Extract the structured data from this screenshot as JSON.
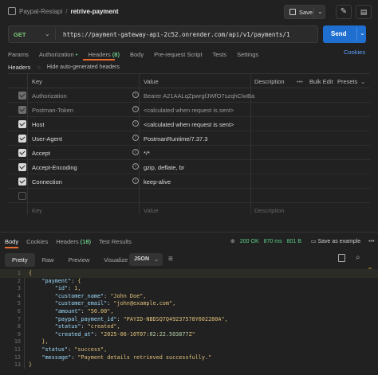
{
  "topbar": {
    "collection": "Paypal-Restapi",
    "separator": "/",
    "request_name": "retrive-payment",
    "save_label": "Save"
  },
  "request": {
    "method": "GET",
    "url": "https://payment-gateway-api-2c52.onrender.com/api/v1/payments/1",
    "send_label": "Send"
  },
  "tabs": [
    {
      "label": "Params"
    },
    {
      "label": "Authorization",
      "dot": "•"
    },
    {
      "label": "Headers",
      "count": "(8)"
    },
    {
      "label": "Body"
    },
    {
      "label": "Pre-request Script"
    },
    {
      "label": "Tests"
    },
    {
      "label": "Settings"
    }
  ],
  "cookies_label": "Cookies",
  "headers_section": {
    "title": "Headers",
    "hide_label": "Hide auto-generated headers",
    "col_key": "Key",
    "col_value": "Value",
    "col_description": "Description",
    "more": "•••",
    "bulk_edit": "Bulk Edit",
    "presets": "Presets",
    "rows": [
      {
        "key": "Authorization",
        "value": "Bearer A21AALqZpwrgfJWfO7szqhClwBa...",
        "state": "dim"
      },
      {
        "key": "Postman-Token",
        "value": "<calculated when request is sent>",
        "state": "dim"
      },
      {
        "key": "Host",
        "value": "<calculated when request is sent>",
        "state": "on"
      },
      {
        "key": "User-Agent",
        "value": "PostmanRuntime/7.37.3",
        "state": "on"
      },
      {
        "key": "Accept",
        "value": "*/*",
        "state": "on"
      },
      {
        "key": "Accept-Encoding",
        "value": "gzip, deflate, br",
        "state": "on"
      },
      {
        "key": "Connection",
        "value": "keep-alive",
        "state": "on"
      }
    ],
    "placeholder_key": "Key",
    "placeholder_value": "Value",
    "placeholder_description": "Description"
  },
  "response": {
    "tabs": [
      {
        "label": "Body"
      },
      {
        "label": "Cookies"
      },
      {
        "label": "Headers",
        "count": "(18)"
      },
      {
        "label": "Test Results"
      }
    ],
    "status": "200 OK",
    "time": "870 ms",
    "size": "801 B",
    "save_example": "Save as example",
    "more": "•••",
    "view_tabs": [
      "Pretty",
      "Raw",
      "Preview",
      "Visualize"
    ],
    "format": "JSON",
    "lines": [
      {
        "n": "1",
        "text": "{"
      },
      {
        "n": "2",
        "text": "    \"payment\": {"
      },
      {
        "n": "3",
        "text": "        \"id\": 1,"
      },
      {
        "n": "4",
        "text": "        \"customer_name\": \"John Doe\","
      },
      {
        "n": "5",
        "text": "        \"customer_email\": \"john@example.com\","
      },
      {
        "n": "6",
        "text": "        \"amount\": \"50.00\","
      },
      {
        "n": "7",
        "text": "        \"paypal_payment_id\": \"PAYID-NBDSQ7Q49237578Y602280A\","
      },
      {
        "n": "8",
        "text": "        \"status\": \"created\","
      },
      {
        "n": "9",
        "text": "        \"created_at\": \"2025-06-10T07:02:22.503877Z\""
      },
      {
        "n": "10",
        "text": "    },"
      },
      {
        "n": "11",
        "text": "    \"status\": \"success\","
      },
      {
        "n": "12",
        "text": "    \"message\": \"Payment details retrieved successfully.\""
      },
      {
        "n": "13",
        "text": "}"
      }
    ]
  },
  "colors": {
    "accent": "#e86a2e",
    "send": "#1f6fd1",
    "method": "#7cc97c",
    "status_ok": "#5dd08a"
  }
}
